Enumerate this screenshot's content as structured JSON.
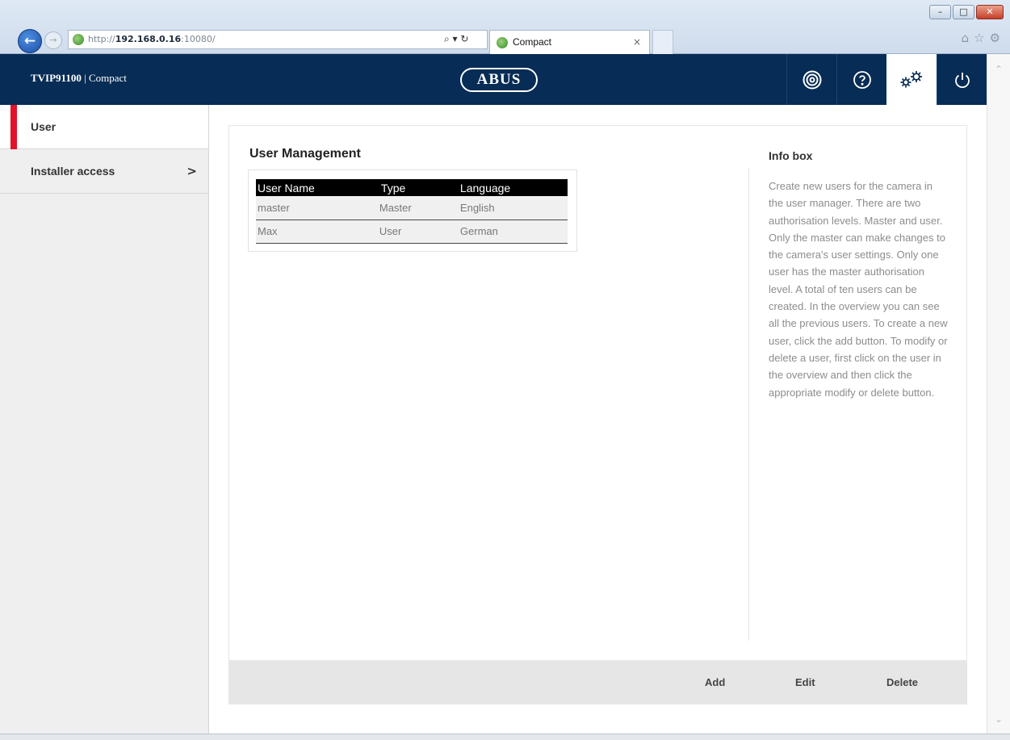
{
  "browser": {
    "url_prefix": "http://",
    "url_host": "192.168.0.16",
    "url_suffix": ":10080/",
    "search_glyphs": "⌕ ▾ ↻",
    "tab_title": "Compact",
    "tab_close": "×",
    "back_glyph": "←",
    "forward_glyph": "→",
    "icons": [
      "home-icon",
      "star-icon",
      "gear-icon"
    ],
    "window_buttons": {
      "minimize": "–",
      "maximize": "□",
      "close": "✕"
    }
  },
  "header": {
    "model": "TVIP91100",
    "separator": "|",
    "product": "Compact",
    "logo": "ABUS",
    "buttons": [
      {
        "icon": "camera-live-icon",
        "active": false
      },
      {
        "icon": "help-icon",
        "active": false
      },
      {
        "icon": "settings-gears-icon",
        "active": true
      },
      {
        "icon": "power-icon",
        "active": false
      }
    ],
    "colors": {
      "header_bg": "#072c55",
      "accent": "#e3122b"
    }
  },
  "sidebar": {
    "items": [
      {
        "label": "User",
        "active": true
      },
      {
        "label": "Installer access",
        "chevron": ">"
      }
    ]
  },
  "main": {
    "title": "User Management",
    "table": {
      "columns": [
        "User Name",
        "Type",
        "Language"
      ],
      "rows": [
        [
          "master",
          "Master",
          "English"
        ],
        [
          "Max",
          "User",
          "German"
        ]
      ]
    },
    "info": {
      "title": "Info box",
      "text": "Create new users for the camera in the user manager. There are two authorisation levels. Master and user. Only the master can make changes to the camera's user settings. Only one user has the master authorisation level. A total of ten users can be created. In the overview you can see all the previous users. To create a new user, click the add button. To modify or delete a user, first click on the user in the overview and then click the appropriate modify or delete button."
    },
    "actions": {
      "add": "Add",
      "edit": "Edit",
      "delete": "Delete"
    }
  }
}
